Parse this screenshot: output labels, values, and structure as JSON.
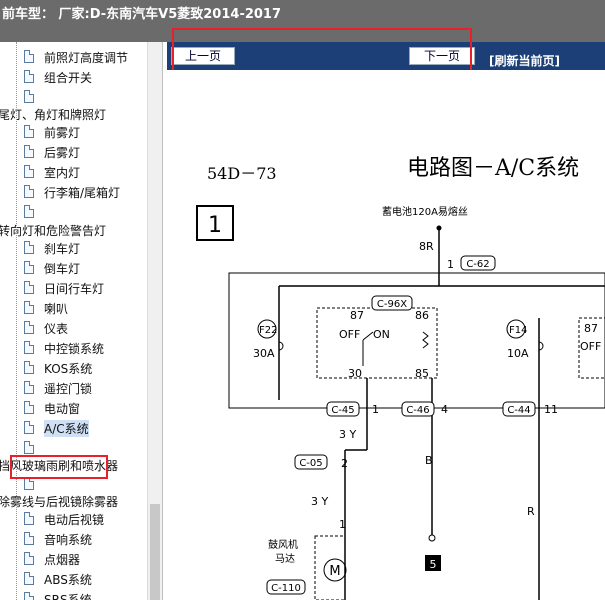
{
  "window": {
    "title": "前车型：  厂家:D-东南汽车V5菱致2014-2017"
  },
  "nav": {
    "prev": "上一页",
    "next": "下一页",
    "refresh": "[刷新当前页]"
  },
  "sidebar": {
    "items": [
      {
        "label": "前照灯高度调节"
      },
      {
        "label": "组合开关"
      },
      {
        "label": ""
      },
      {
        "label": "尾灯、角灯和牌照灯"
      },
      {
        "label": "前雾灯"
      },
      {
        "label": "后雾灯"
      },
      {
        "label": "室内灯"
      },
      {
        "label": "行李箱/尾箱灯"
      },
      {
        "label": ""
      },
      {
        "label": "转向灯和危险警告灯"
      },
      {
        "label": "刹车灯"
      },
      {
        "label": "倒车灯"
      },
      {
        "label": "日间行车灯"
      },
      {
        "label": "喇叭"
      },
      {
        "label": "仪表"
      },
      {
        "label": "中控锁系统"
      },
      {
        "label": "KOS系统"
      },
      {
        "label": "遥控门锁"
      },
      {
        "label": "电动窗"
      },
      {
        "label": "A/C系统"
      },
      {
        "label": ""
      },
      {
        "label": "挡风玻璃雨刷和喷水器"
      },
      {
        "label": ""
      },
      {
        "label": "除雾线与后视镜除雾器"
      },
      {
        "label": "电动后视镜"
      },
      {
        "label": "音响系统"
      },
      {
        "label": "点烟器"
      },
      {
        "label": "ABS系统"
      },
      {
        "label": "SRS系统"
      }
    ]
  },
  "diagram": {
    "page": "54D－73",
    "title": "电路图－A/C系统",
    "box": "1",
    "battery": "蓄电池120A易熔丝",
    "wire_8r": "8R",
    "pin1": "1",
    "c62": "C-62",
    "c96x": "C-96X",
    "f22": "F22",
    "f22_amp": "30A",
    "f14": "F14",
    "f14_amp": "10A",
    "relay_87": "87",
    "relay_86": "86",
    "relay_off": "OFF",
    "relay_on": "ON",
    "relay_30": "30",
    "relay_85": "85",
    "r87": "87",
    "roff": "OFF",
    "c45": "C-45",
    "c45_pin": "1",
    "c46": "C-46",
    "c46_pin": "4",
    "c44": "C-44",
    "c44_pin": "11",
    "w3y_a": "3 Y",
    "c05": "C-05",
    "c05_pin": "2",
    "w_b": "B",
    "w_r": "R",
    "w3y_b": "3 Y",
    "pin1b": "1",
    "ground": "5",
    "motor_label": "鼓风机\n马达",
    "motor": "M",
    "c110": "C-110"
  },
  "colors": {
    "titlebar": "#6b6b6b",
    "navbar": "#1c3f78",
    "highlight": "#e8202a"
  }
}
